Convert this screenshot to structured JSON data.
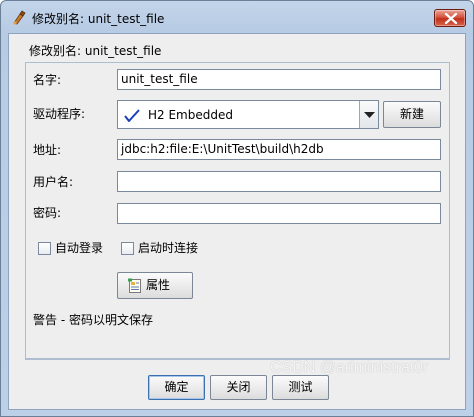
{
  "window": {
    "title": "修改别名: unit_test_file",
    "header": "修改别名: unit_test_file"
  },
  "form": {
    "name_label": "名字:",
    "name_value": "unit_test_file",
    "driver_label": "驱动程序:",
    "driver_value": "H2 Embedded",
    "new_button": "新建",
    "url_label": "地址:",
    "url_value": "jdbc:h2:file:E:\\UnitTest\\build\\h2db",
    "user_label": "用户名:",
    "user_value": "",
    "password_label": "密码:",
    "password_value": ""
  },
  "options": {
    "auto_login_label": "自动登录",
    "auto_login_checked": false,
    "connect_on_start_label": "启动时连接",
    "connect_on_start_checked": false
  },
  "properties_button": "属性",
  "warning_text": "警告 - 密码以明文保存",
  "footer": {
    "ok_button": "确定",
    "close_button": "关闭",
    "test_button": "测试"
  },
  "watermark": "CSDN @administrat0r",
  "icons": {
    "app": "app-icon",
    "close": "close-icon",
    "driver_check": "check-icon",
    "dropdown": "chevron-down-icon",
    "properties": "properties-icon"
  },
  "colors": {
    "title_bar": "#bcd0e8",
    "dialog_bg": "#eeeeee",
    "close_button": "#c0321d",
    "check_mark": "#1a3fb8"
  }
}
